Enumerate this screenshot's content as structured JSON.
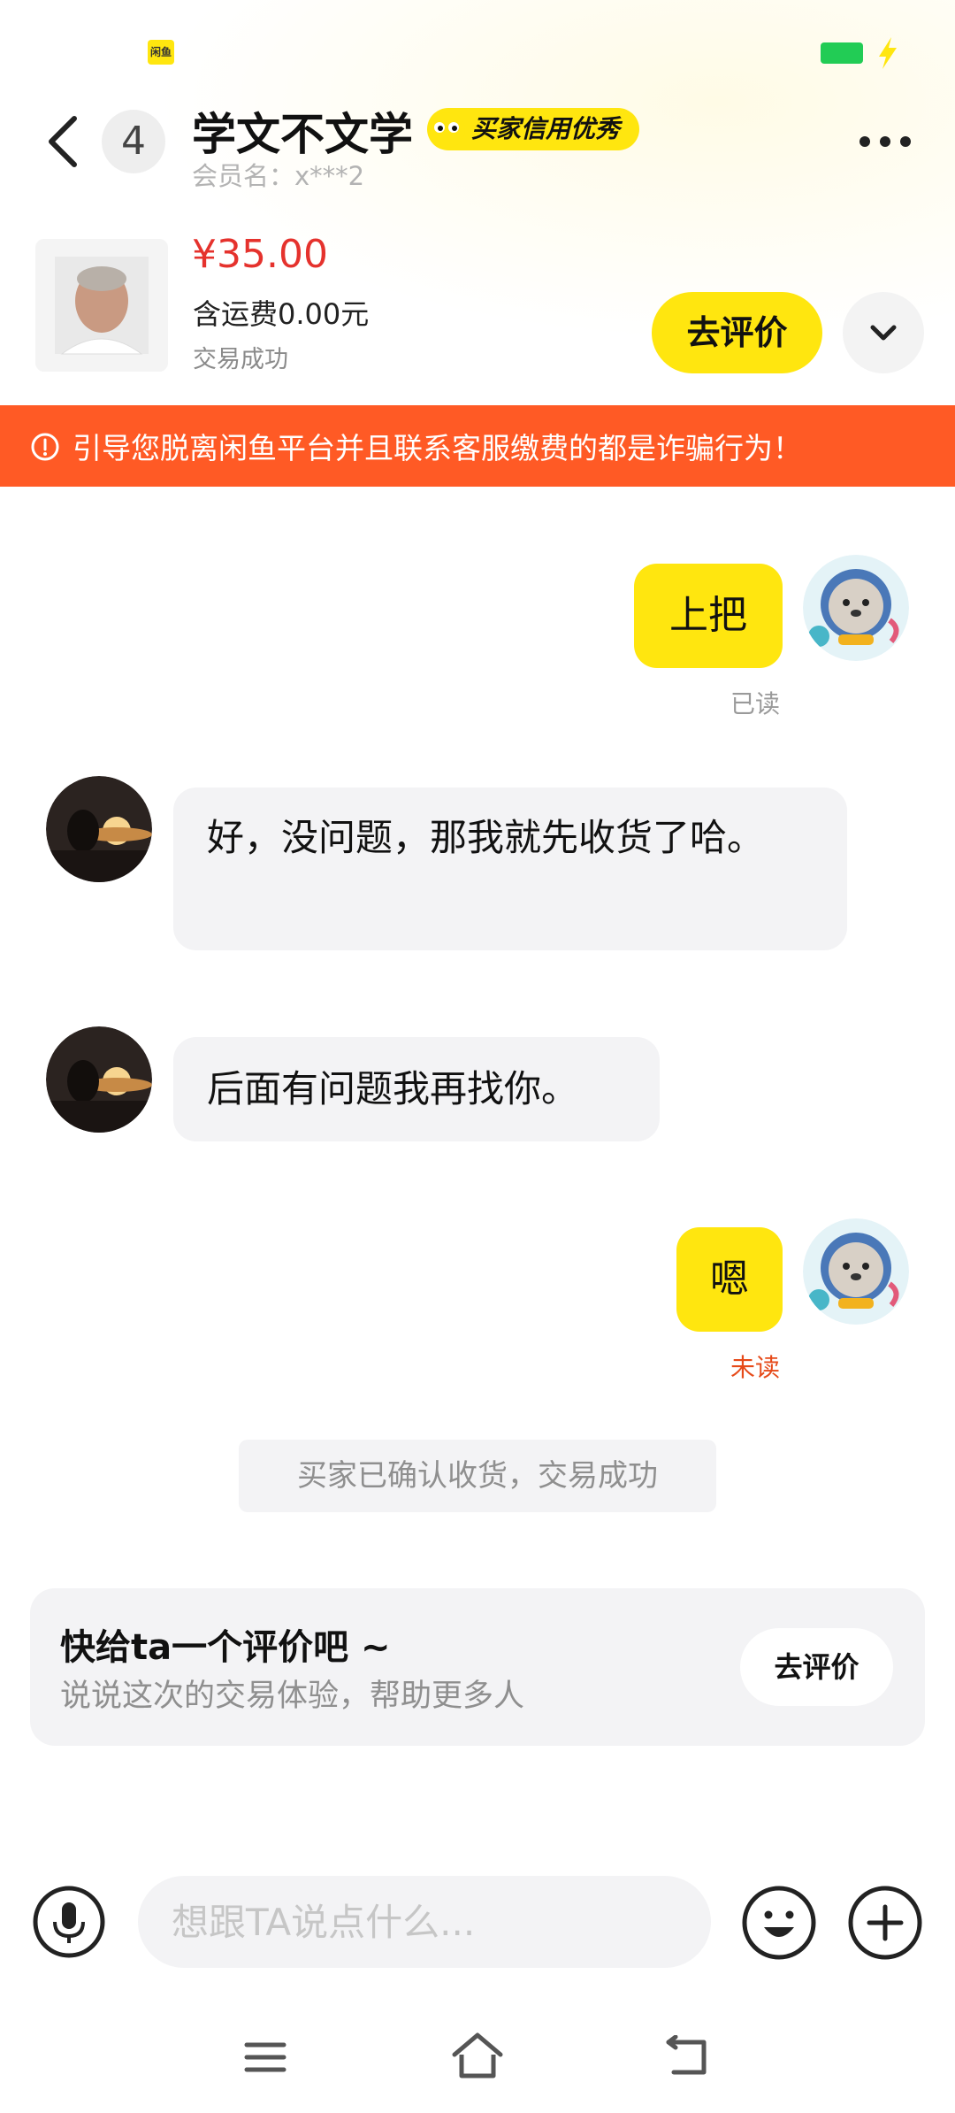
{
  "status_bar": {
    "app_icon": "闲鱼",
    "battery_color": "#22cc55",
    "icons": [
      "battery-icon",
      "charging-icon"
    ]
  },
  "header": {
    "unread_count": "4",
    "username": "学文不文学",
    "credit_badge": "买家信用优秀",
    "member_name": "会员名：x***2",
    "icons": [
      "back-icon",
      "more-icon"
    ]
  },
  "product": {
    "price": "¥35.00",
    "shipping": "含运费0.00元",
    "status": "交易成功",
    "rate_button": "去评价"
  },
  "warning": {
    "text": "引导您脱离闲鱼平台并且联系客服缴费的都是诈骗行为！"
  },
  "messages": [
    {
      "sender": "me",
      "text": "上把",
      "status": "已读"
    },
    {
      "sender": "other",
      "text": "好，没问题，那我就先收货了哈。"
    },
    {
      "sender": "other",
      "text": "后面有问题我再找你。"
    },
    {
      "sender": "me",
      "text": "嗯",
      "status": "未读"
    }
  ],
  "system_notice": "买家已确认收货，交易成功",
  "review_card": {
    "title": "快给ta一个评价吧 ~",
    "subtitle": "说说这次的交易体验，帮助更多人",
    "button": "去评价"
  },
  "input_bar": {
    "placeholder": "想跟TA说点什么...",
    "value": "",
    "icons": [
      "microphone-icon",
      "emoji-icon",
      "plus-icon"
    ]
  },
  "nav_bar": {
    "icons": [
      "menu-icon",
      "home-icon",
      "back-nav-icon"
    ]
  },
  "colors": {
    "accent": "#ffe60f",
    "warning": "#ff5a25",
    "price": "#e5322d",
    "unread": "#e64a19"
  }
}
